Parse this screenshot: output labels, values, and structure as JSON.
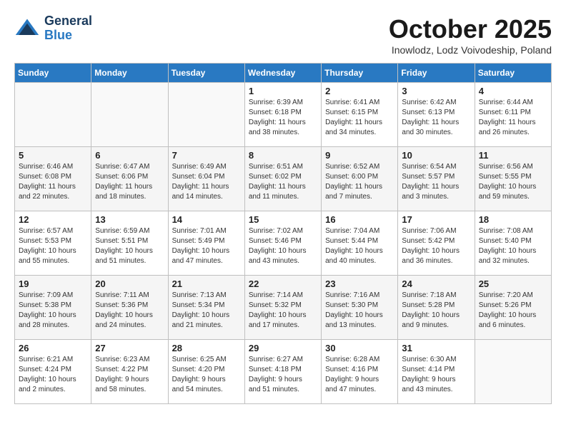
{
  "header": {
    "logo_general": "General",
    "logo_blue": "Blue",
    "month": "October 2025",
    "location": "Inowlodz, Lodz Voivodeship, Poland"
  },
  "days_of_week": [
    "Sunday",
    "Monday",
    "Tuesday",
    "Wednesday",
    "Thursday",
    "Friday",
    "Saturday"
  ],
  "weeks": [
    [
      {
        "day": "",
        "info": ""
      },
      {
        "day": "",
        "info": ""
      },
      {
        "day": "",
        "info": ""
      },
      {
        "day": "1",
        "info": "Sunrise: 6:39 AM\nSunset: 6:18 PM\nDaylight: 11 hours\nand 38 minutes."
      },
      {
        "day": "2",
        "info": "Sunrise: 6:41 AM\nSunset: 6:15 PM\nDaylight: 11 hours\nand 34 minutes."
      },
      {
        "day": "3",
        "info": "Sunrise: 6:42 AM\nSunset: 6:13 PM\nDaylight: 11 hours\nand 30 minutes."
      },
      {
        "day": "4",
        "info": "Sunrise: 6:44 AM\nSunset: 6:11 PM\nDaylight: 11 hours\nand 26 minutes."
      }
    ],
    [
      {
        "day": "5",
        "info": "Sunrise: 6:46 AM\nSunset: 6:08 PM\nDaylight: 11 hours\nand 22 minutes."
      },
      {
        "day": "6",
        "info": "Sunrise: 6:47 AM\nSunset: 6:06 PM\nDaylight: 11 hours\nand 18 minutes."
      },
      {
        "day": "7",
        "info": "Sunrise: 6:49 AM\nSunset: 6:04 PM\nDaylight: 11 hours\nand 14 minutes."
      },
      {
        "day": "8",
        "info": "Sunrise: 6:51 AM\nSunset: 6:02 PM\nDaylight: 11 hours\nand 11 minutes."
      },
      {
        "day": "9",
        "info": "Sunrise: 6:52 AM\nSunset: 6:00 PM\nDaylight: 11 hours\nand 7 minutes."
      },
      {
        "day": "10",
        "info": "Sunrise: 6:54 AM\nSunset: 5:57 PM\nDaylight: 11 hours\nand 3 minutes."
      },
      {
        "day": "11",
        "info": "Sunrise: 6:56 AM\nSunset: 5:55 PM\nDaylight: 10 hours\nand 59 minutes."
      }
    ],
    [
      {
        "day": "12",
        "info": "Sunrise: 6:57 AM\nSunset: 5:53 PM\nDaylight: 10 hours\nand 55 minutes."
      },
      {
        "day": "13",
        "info": "Sunrise: 6:59 AM\nSunset: 5:51 PM\nDaylight: 10 hours\nand 51 minutes."
      },
      {
        "day": "14",
        "info": "Sunrise: 7:01 AM\nSunset: 5:49 PM\nDaylight: 10 hours\nand 47 minutes."
      },
      {
        "day": "15",
        "info": "Sunrise: 7:02 AM\nSunset: 5:46 PM\nDaylight: 10 hours\nand 43 minutes."
      },
      {
        "day": "16",
        "info": "Sunrise: 7:04 AM\nSunset: 5:44 PM\nDaylight: 10 hours\nand 40 minutes."
      },
      {
        "day": "17",
        "info": "Sunrise: 7:06 AM\nSunset: 5:42 PM\nDaylight: 10 hours\nand 36 minutes."
      },
      {
        "day": "18",
        "info": "Sunrise: 7:08 AM\nSunset: 5:40 PM\nDaylight: 10 hours\nand 32 minutes."
      }
    ],
    [
      {
        "day": "19",
        "info": "Sunrise: 7:09 AM\nSunset: 5:38 PM\nDaylight: 10 hours\nand 28 minutes."
      },
      {
        "day": "20",
        "info": "Sunrise: 7:11 AM\nSunset: 5:36 PM\nDaylight: 10 hours\nand 24 minutes."
      },
      {
        "day": "21",
        "info": "Sunrise: 7:13 AM\nSunset: 5:34 PM\nDaylight: 10 hours\nand 21 minutes."
      },
      {
        "day": "22",
        "info": "Sunrise: 7:14 AM\nSunset: 5:32 PM\nDaylight: 10 hours\nand 17 minutes."
      },
      {
        "day": "23",
        "info": "Sunrise: 7:16 AM\nSunset: 5:30 PM\nDaylight: 10 hours\nand 13 minutes."
      },
      {
        "day": "24",
        "info": "Sunrise: 7:18 AM\nSunset: 5:28 PM\nDaylight: 10 hours\nand 9 minutes."
      },
      {
        "day": "25",
        "info": "Sunrise: 7:20 AM\nSunset: 5:26 PM\nDaylight: 10 hours\nand 6 minutes."
      }
    ],
    [
      {
        "day": "26",
        "info": "Sunrise: 6:21 AM\nSunset: 4:24 PM\nDaylight: 10 hours\nand 2 minutes."
      },
      {
        "day": "27",
        "info": "Sunrise: 6:23 AM\nSunset: 4:22 PM\nDaylight: 9 hours\nand 58 minutes."
      },
      {
        "day": "28",
        "info": "Sunrise: 6:25 AM\nSunset: 4:20 PM\nDaylight: 9 hours\nand 54 minutes."
      },
      {
        "day": "29",
        "info": "Sunrise: 6:27 AM\nSunset: 4:18 PM\nDaylight: 9 hours\nand 51 minutes."
      },
      {
        "day": "30",
        "info": "Sunrise: 6:28 AM\nSunset: 4:16 PM\nDaylight: 9 hours\nand 47 minutes."
      },
      {
        "day": "31",
        "info": "Sunrise: 6:30 AM\nSunset: 4:14 PM\nDaylight: 9 hours\nand 43 minutes."
      },
      {
        "day": "",
        "info": ""
      }
    ]
  ]
}
